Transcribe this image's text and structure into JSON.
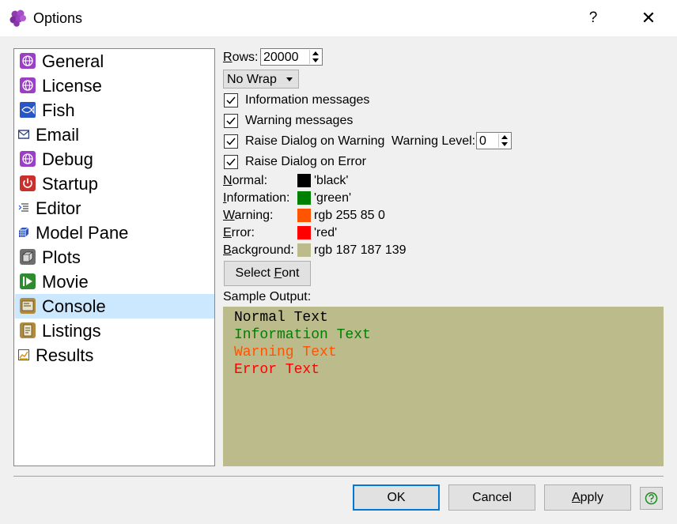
{
  "window": {
    "title": "Options",
    "help_label": "?",
    "close_label": "✕"
  },
  "nav": {
    "items": [
      {
        "label": "General",
        "icon": "globe-icon"
      },
      {
        "label": "License",
        "icon": "globe-icon"
      },
      {
        "label": "Fish",
        "icon": "fish-icon"
      },
      {
        "label": "Email",
        "icon": "mail-icon"
      },
      {
        "label": "Debug",
        "icon": "globe-icon"
      },
      {
        "label": "Startup",
        "icon": "power-icon"
      },
      {
        "label": "Editor",
        "icon": "editor-icon"
      },
      {
        "label": "Model Pane",
        "icon": "cube-icon"
      },
      {
        "label": "Plots",
        "icon": "box-icon"
      },
      {
        "label": "Movie",
        "icon": "play-icon"
      },
      {
        "label": "Console",
        "icon": "console-icon"
      },
      {
        "label": "Listings",
        "icon": "listing-icon"
      },
      {
        "label": "Results",
        "icon": "chart-icon"
      }
    ],
    "selected": "Console"
  },
  "console": {
    "rows_label": "Rows:",
    "rows_label_ul": "R",
    "rows_label_rest": "ows:",
    "rows_value": "20000",
    "wrap_value": "No Wrap",
    "checks": {
      "info": {
        "label": "Information messages",
        "checked": true
      },
      "warning": {
        "label": "Warning messages",
        "checked": true
      },
      "raise_warning": {
        "label": "Raise Dialog on Warning",
        "checked": true
      },
      "raise_error": {
        "label": "Raise Dialog on Error",
        "checked": true
      }
    },
    "warning_level_label": "Warning Level:",
    "warning_level_value": "0",
    "colors": {
      "normal": {
        "label_ul": "N",
        "label_rest": "ormal:",
        "value": "'black'",
        "hex": "#000000"
      },
      "information": {
        "label_ul": "I",
        "label_rest": "nformation:",
        "value": "'green'",
        "hex": "#008000"
      },
      "warning": {
        "label_ul": "W",
        "label_rest": "arning:",
        "value": "rgb 255 85 0",
        "hex": "#ff5500"
      },
      "error": {
        "label_ul": "E",
        "label_rest": "rror:",
        "value": "'red'",
        "hex": "#ff0000"
      },
      "background": {
        "label_ul": "B",
        "label_rest": "ackground:",
        "value": "rgb 187 187 139",
        "hex": "#bbbb8b"
      }
    },
    "font_button": {
      "pre": "Select ",
      "ul": "F",
      "post": "ont"
    },
    "sample_label": "Sample Output:",
    "sample_lines": {
      "normal": "Normal Text",
      "information": "Information Text",
      "warning": "Warning Text",
      "error": "Error Text"
    }
  },
  "footer": {
    "ok_label": "OK",
    "cancel_label": "Cancel",
    "apply_ul": "A",
    "apply_rest": "pply",
    "help_icon": "help-icon"
  }
}
